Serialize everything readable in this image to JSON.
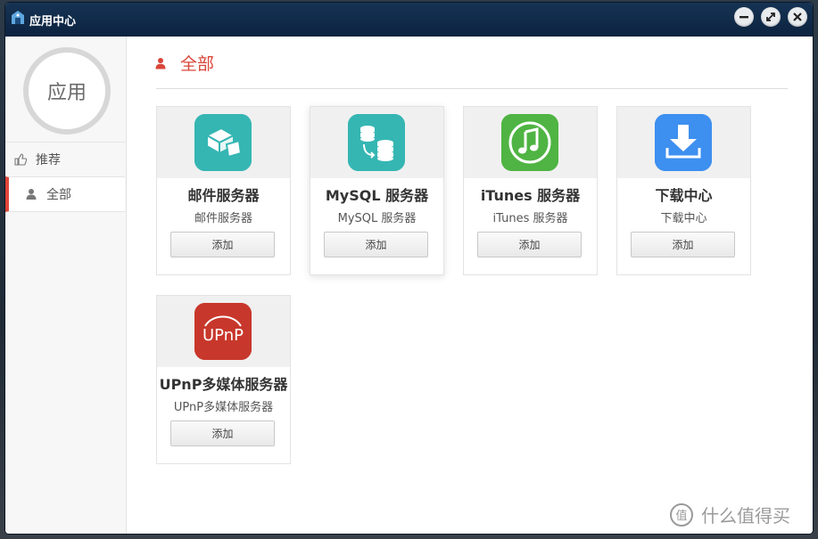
{
  "window": {
    "title": "应用中心"
  },
  "sidebar": {
    "logo_text": "应用",
    "items": [
      {
        "label": "推荐",
        "icon": "thumbs-up-icon",
        "active": false
      },
      {
        "label": "全部",
        "icon": "user-icon",
        "active": true
      }
    ]
  },
  "main": {
    "heading": "全部",
    "apps": [
      {
        "name": "邮件服务器",
        "description": "邮件服务器",
        "add_label": "添加",
        "icon": "mail-server-icon",
        "icon_color": "#35b6b3"
      },
      {
        "name": "MySQL 服务器",
        "description": "MySQL 服务器",
        "add_label": "添加",
        "icon": "mysql-database-icon",
        "icon_color": "#35b6b3"
      },
      {
        "name": "iTunes 服务器",
        "description": "iTunes 服务器",
        "add_label": "添加",
        "icon": "music-note-icon",
        "icon_color": "#52b947"
      },
      {
        "name": "下载中心",
        "description": "下载中心",
        "add_label": "添加",
        "icon": "download-icon",
        "icon_color": "#3d8ff0"
      },
      {
        "name": "UPnP多媒体服务器",
        "description": "UPnP多媒体服务器",
        "add_label": "添加",
        "icon": "upnp-icon",
        "icon_color": "#c8372b",
        "icon_text": "UPnP"
      }
    ]
  },
  "watermark": {
    "text": "什么值得买"
  },
  "colors": {
    "accent": "#d9453a",
    "titlebar": "#0c2340"
  }
}
